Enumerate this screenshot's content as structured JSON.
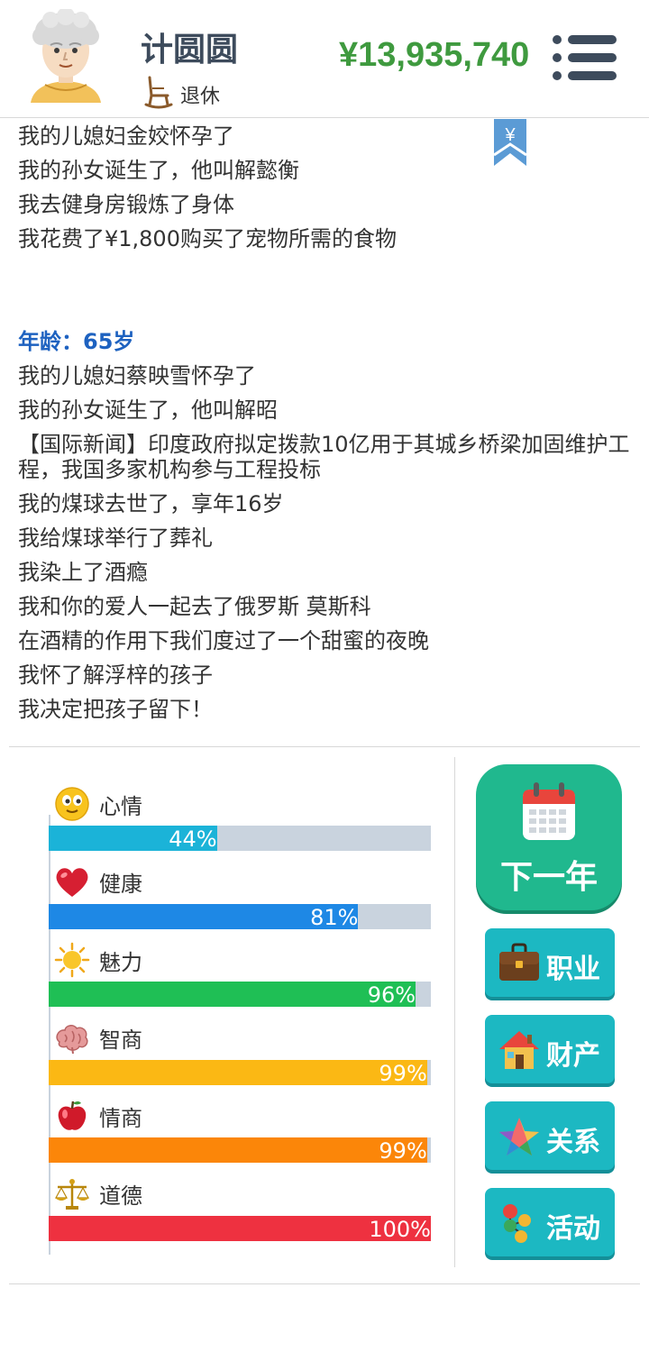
{
  "header": {
    "name": "计圆圆",
    "status": "退休",
    "money": "¥13,935,740"
  },
  "log": {
    "lines_before": [
      "我的儿媳妇金姣怀孕了",
      "我的孙女诞生了，他叫解懿衡",
      "我去健身房锻炼了身体",
      "我花费了¥1,800购买了宠物所需的食物"
    ],
    "age_label": "年龄：65岁",
    "lines_after": [
      "我的儿媳妇蔡映雪怀孕了",
      "我的孙女诞生了，他叫解昭",
      "【国际新闻】印度政府拟定拨款10亿用于其城乡桥梁加固维护工程，我国多家机构参与工程投标",
      "我的煤球去世了，享年16岁",
      "我给煤球举行了葬礼",
      "我染上了酒瘾",
      "我和你的爱人一起去了俄罗斯 莫斯科",
      "在酒精的作用下我们度过了一个甜蜜的夜晚",
      "我怀了解浮梓的孩子",
      "我决定把孩子留下！"
    ],
    "bookmark_symbol": "¥"
  },
  "stats": [
    {
      "label": "心情",
      "value": 44,
      "pct": "44%",
      "color": "#1bb3d8",
      "icon": "smiley-icon"
    },
    {
      "label": "健康",
      "value": 81,
      "pct": "81%",
      "color": "#1e88e5",
      "icon": "heart-icon"
    },
    {
      "label": "魅力",
      "value": 96,
      "pct": "96%",
      "color": "#1fbf55",
      "icon": "sun-icon"
    },
    {
      "label": "智商",
      "value": 99,
      "pct": "99%",
      "color": "#fbb814",
      "icon": "brain-icon"
    },
    {
      "label": "情商",
      "value": 99,
      "pct": "99%",
      "color": "#fb8609",
      "icon": "apple-icon"
    },
    {
      "label": "道德",
      "value": 100,
      "pct": "100%",
      "color": "#ee3140",
      "icon": "scales-icon"
    }
  ],
  "actions": {
    "next_year": "下一年",
    "career": "职业",
    "property": "财产",
    "relations": "关系",
    "activities": "活动"
  },
  "colors": {
    "money": "#3f9a3f",
    "age": "#1e62c0",
    "next_year_button": "#20b88e",
    "action_button": "#1cb8c2"
  }
}
